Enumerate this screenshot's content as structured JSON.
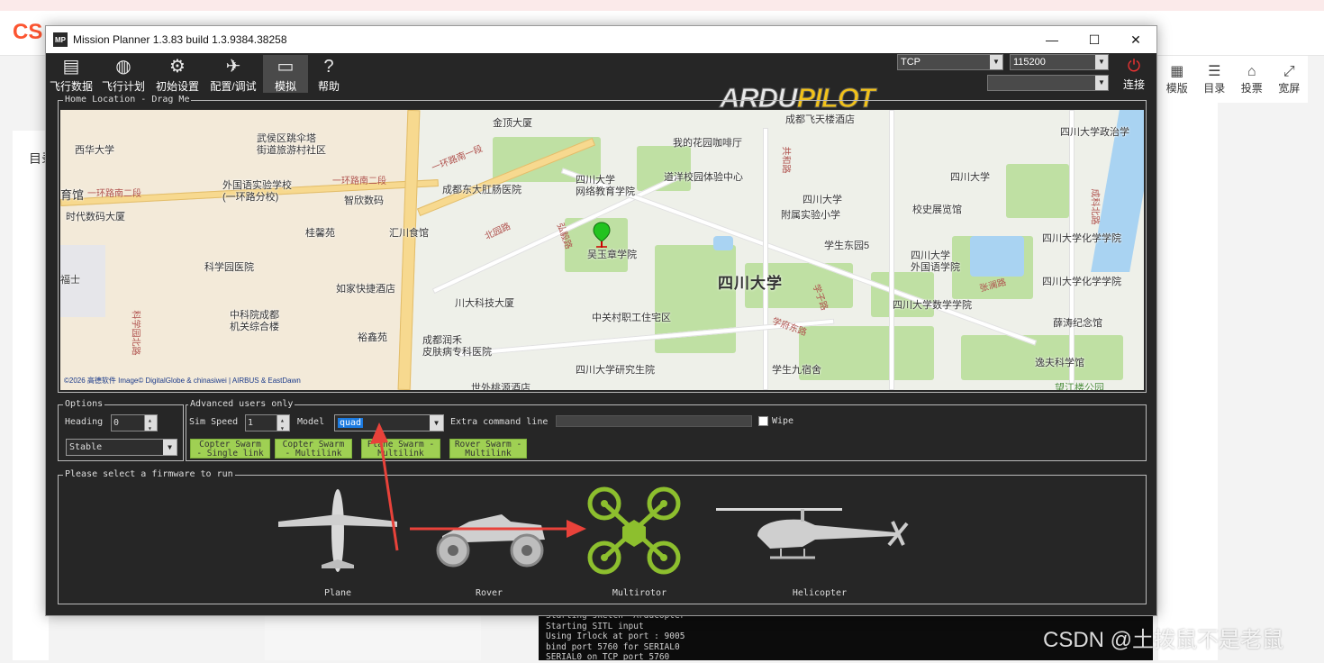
{
  "browser": {
    "logo": "CS",
    "toc": "目录",
    "tools": [
      {
        "icon": "layout-icon",
        "label": "模版"
      },
      {
        "icon": "list-icon",
        "label": "目录"
      },
      {
        "icon": "vote-icon",
        "label": "投票"
      },
      {
        "icon": "expand-icon",
        "label": "宽屏"
      }
    ],
    "terminal_lines": [
      "Starting sketch 'ArduCopter'",
      "Starting SITL input",
      "Using Irlock at port : 9005",
      "bind port 5760 for SERIAL0",
      "SERIAL0 on TCP port 5760"
    ],
    "watermark": "CSDN @土拨鼠不是老鼠"
  },
  "window": {
    "title": "Mission Planner 1.3.83 build 1.3.9384.38258",
    "app_icon": "MP",
    "minimize": "—",
    "maximize": "☐",
    "close": "✕"
  },
  "toolbar": {
    "items": [
      {
        "label": "飞行数据",
        "icon": "flight-data-icon"
      },
      {
        "label": "飞行计划",
        "icon": "flight-plan-icon"
      },
      {
        "label": "初始设置",
        "icon": "initial-setup-icon"
      },
      {
        "label": "配置/调试",
        "icon": "config-tuning-icon"
      },
      {
        "label": "模拟",
        "icon": "simulation-icon"
      },
      {
        "label": "帮助",
        "icon": "help-icon"
      }
    ],
    "logo_a": "ARDU",
    "logo_b": "PILOT",
    "connection_type": "TCP",
    "baud_rate": "115200",
    "port": "",
    "connect_label": "连接"
  },
  "map": {
    "legend": "Home Location - Drag Me",
    "copyright": "©2026 高德软件 Image© DigitalGlobe & chinasiwei | AIRBUS & EastDawn",
    "labels": {
      "jinding": "金顶大厦",
      "feitian": "成都飞天楼酒店",
      "scu_politics": "四川大学政治学",
      "xihua": "西华大学",
      "wuhou": "武侯区跳伞塔\n街道旅游村社区",
      "coffee": "我的花园咖啡厅",
      "ring2a": "一环路南二段",
      "ring2b": "一环路南二段",
      "ring1": "一环路南一段",
      "guan": "育馆",
      "waiguoyu": "外国语实验学校\n(一环路分校)",
      "zhixin": "智欣数码",
      "dongda": "成都东大肛肠医院",
      "wangluo": "四川大学\n网络教育学院",
      "daoyang": "道洋校园体验中心",
      "scu_main": "四川大学",
      "shidai": "时代数码大厦",
      "fushi": "附属实验小学",
      "scu_fushi": "四川大学",
      "xiaoyou": "校史展览馆",
      "guixin": "桂馨苑",
      "huichuan": "汇川食馆",
      "wuyuzhang": "吴玉章学院",
      "xuesheng5": "学生东园5",
      "huaxue": "四川大学化学学院",
      "kexue": "科学园医院",
      "fufu": "福士",
      "scu_big": "四川大学",
      "waiyu": "四川大学\n外国语学院",
      "huaxue2": "四川大学化学学院",
      "rujia": "如家快捷酒店",
      "chuanda": "川大科技大厦",
      "shuxue": "四川大学数学学院",
      "zhongke": "中科院成都\n机关综合楼",
      "zhongguancun": "中关村职工住宅区",
      "xuetao": "薛涛纪念馆",
      "yuxin": "裕鑫苑",
      "runhe": "成都润禾\n皮肤病专科医院",
      "yanjiusheng": "四川大学研究生院",
      "xuesheng9": "学生九宿舍",
      "yifu": "逸夫科学馆",
      "beiyuan": "北园路",
      "honghou": "弘毅路",
      "xuefu": "学府东路",
      "xuezi": "学子路",
      "zhangjia": "张澜路",
      "chengke": "成科北路",
      "jiaoyu": "共和路",
      "shiwai": "世外桃源酒店",
      "keyuan": "科学园北路",
      "lanlong": "望江楼公园"
    }
  },
  "options": {
    "legend": "Options",
    "heading_label": "Heading",
    "heading_value": "0",
    "mode_value": "Stable"
  },
  "advanced": {
    "legend": "Advanced users only",
    "sim_speed_label": "Sim Speed",
    "sim_speed_value": "1",
    "model_label": "Model",
    "model_value": "quad",
    "extra_label": "Extra command line",
    "extra_value": "",
    "wipe_label": "Wipe",
    "buttons": [
      {
        "line1": "Copter Swarm",
        "line2": "- Single link"
      },
      {
        "line1": "Copter Swarm",
        "line2": "- Multilink"
      },
      {
        "line1": "Plane Swarm -",
        "line2": "Multilink"
      },
      {
        "line1": "Rover Swarm -",
        "line2": "Multilink"
      }
    ]
  },
  "firmware": {
    "legend": "Please select a firmware to run",
    "items": [
      {
        "label": "Plane",
        "icon": "plane-icon"
      },
      {
        "label": "Rover",
        "icon": "rover-icon"
      },
      {
        "label": "Multirotor",
        "icon": "multirotor-icon"
      },
      {
        "label": "Helicopter",
        "icon": "helicopter-icon"
      }
    ]
  },
  "colors": {
    "accent_green": "#8dbf2e",
    "annotation_red": "#e8423a",
    "button_green": "#9fd053"
  }
}
